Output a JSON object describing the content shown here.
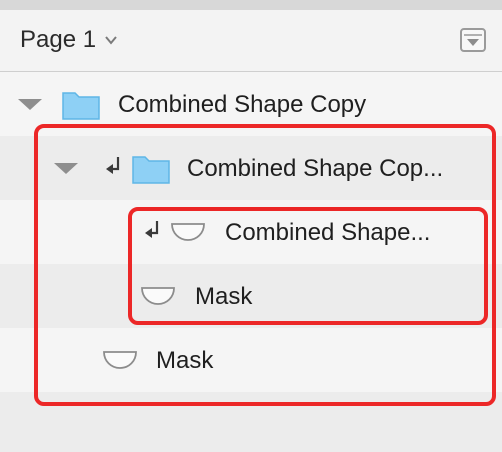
{
  "header": {
    "page_label": "Page 1",
    "page_chevron_icon": "chevron-down-icon",
    "collapse_icon": "collapse-panel-icon"
  },
  "layers": [
    {
      "label": "Combined Shape Copy",
      "icon": "folder-icon",
      "expanded": true,
      "clipped": false
    },
    {
      "label": "Combined Shape Cop...",
      "icon": "folder-icon",
      "expanded": true,
      "clipped": true
    },
    {
      "label": "Combined Shape...",
      "icon": "mask-shape-icon",
      "expanded": false,
      "clipped": true
    },
    {
      "label": "Mask",
      "icon": "mask-shape-icon",
      "expanded": false,
      "clipped": false
    },
    {
      "label": "Mask",
      "icon": "mask-shape-icon",
      "expanded": false,
      "clipped": false
    }
  ],
  "colors": {
    "highlight": "#ec2727",
    "folder": "#8ed0f5",
    "background": "#ececec"
  }
}
